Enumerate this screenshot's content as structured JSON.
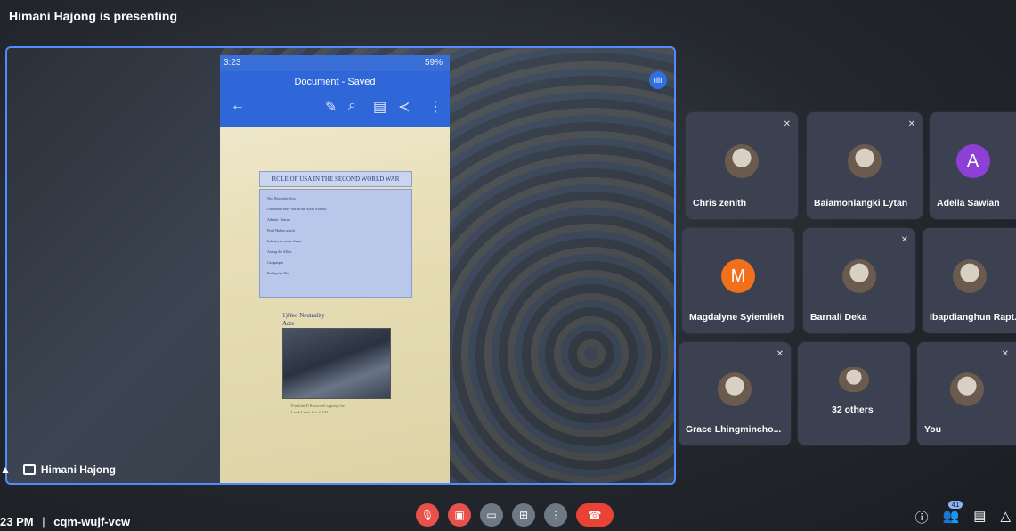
{
  "presenting_banner": "Himani Hajong is presenting",
  "presenter_name": "Himani Hajong",
  "phone": {
    "time": "3:23",
    "battery": "59%",
    "doc_title": "Document - Saved",
    "slide_title": "ROLE OF USA IN THE SECOND WORLD WAR",
    "bullets": [
      "Neo Neutrality Acts",
      "Unleashed navy war in the North Atlantic",
      "Atlantic Charter",
      "Pearl Harbor attack",
      "Industry at war in Japan",
      "Aiding the Allies",
      "Campaigns",
      "Ending the War"
    ],
    "section_heading_line1": "1)Neo Neutrality",
    "section_heading_line2": "Acts",
    "caption_line1": "Franklin D Roosevelt signing the",
    "caption_line2": "Lend-Lease Act of 1941"
  },
  "participants": [
    {
      "name": "Chris zenith",
      "type": "photo",
      "muted": true
    },
    {
      "name": "Baiamonlangki Lytan",
      "type": "photo",
      "muted": true
    },
    {
      "name": "Adella Sawian",
      "type": "letter",
      "letter": "A",
      "color": "#8e3fd6",
      "muted": false
    },
    {
      "name": "Magdalyne Syiemlieh",
      "type": "letter",
      "letter": "M",
      "color": "#f2701c",
      "muted": false
    },
    {
      "name": "Barnali Deka",
      "type": "photo",
      "muted": true
    },
    {
      "name": "Ibapdianghun Rapt...",
      "type": "photo",
      "muted": false
    },
    {
      "name": "Grace Lhingmincho...",
      "type": "photo",
      "muted": true
    },
    {
      "name": "32 others",
      "type": "group",
      "muted": false
    },
    {
      "name": "You",
      "type": "photo",
      "muted": true
    }
  ],
  "footer": {
    "time": "23 PM",
    "separator": "|",
    "meeting_code": "cqm-wujf-vcw",
    "participant_count": "41"
  }
}
